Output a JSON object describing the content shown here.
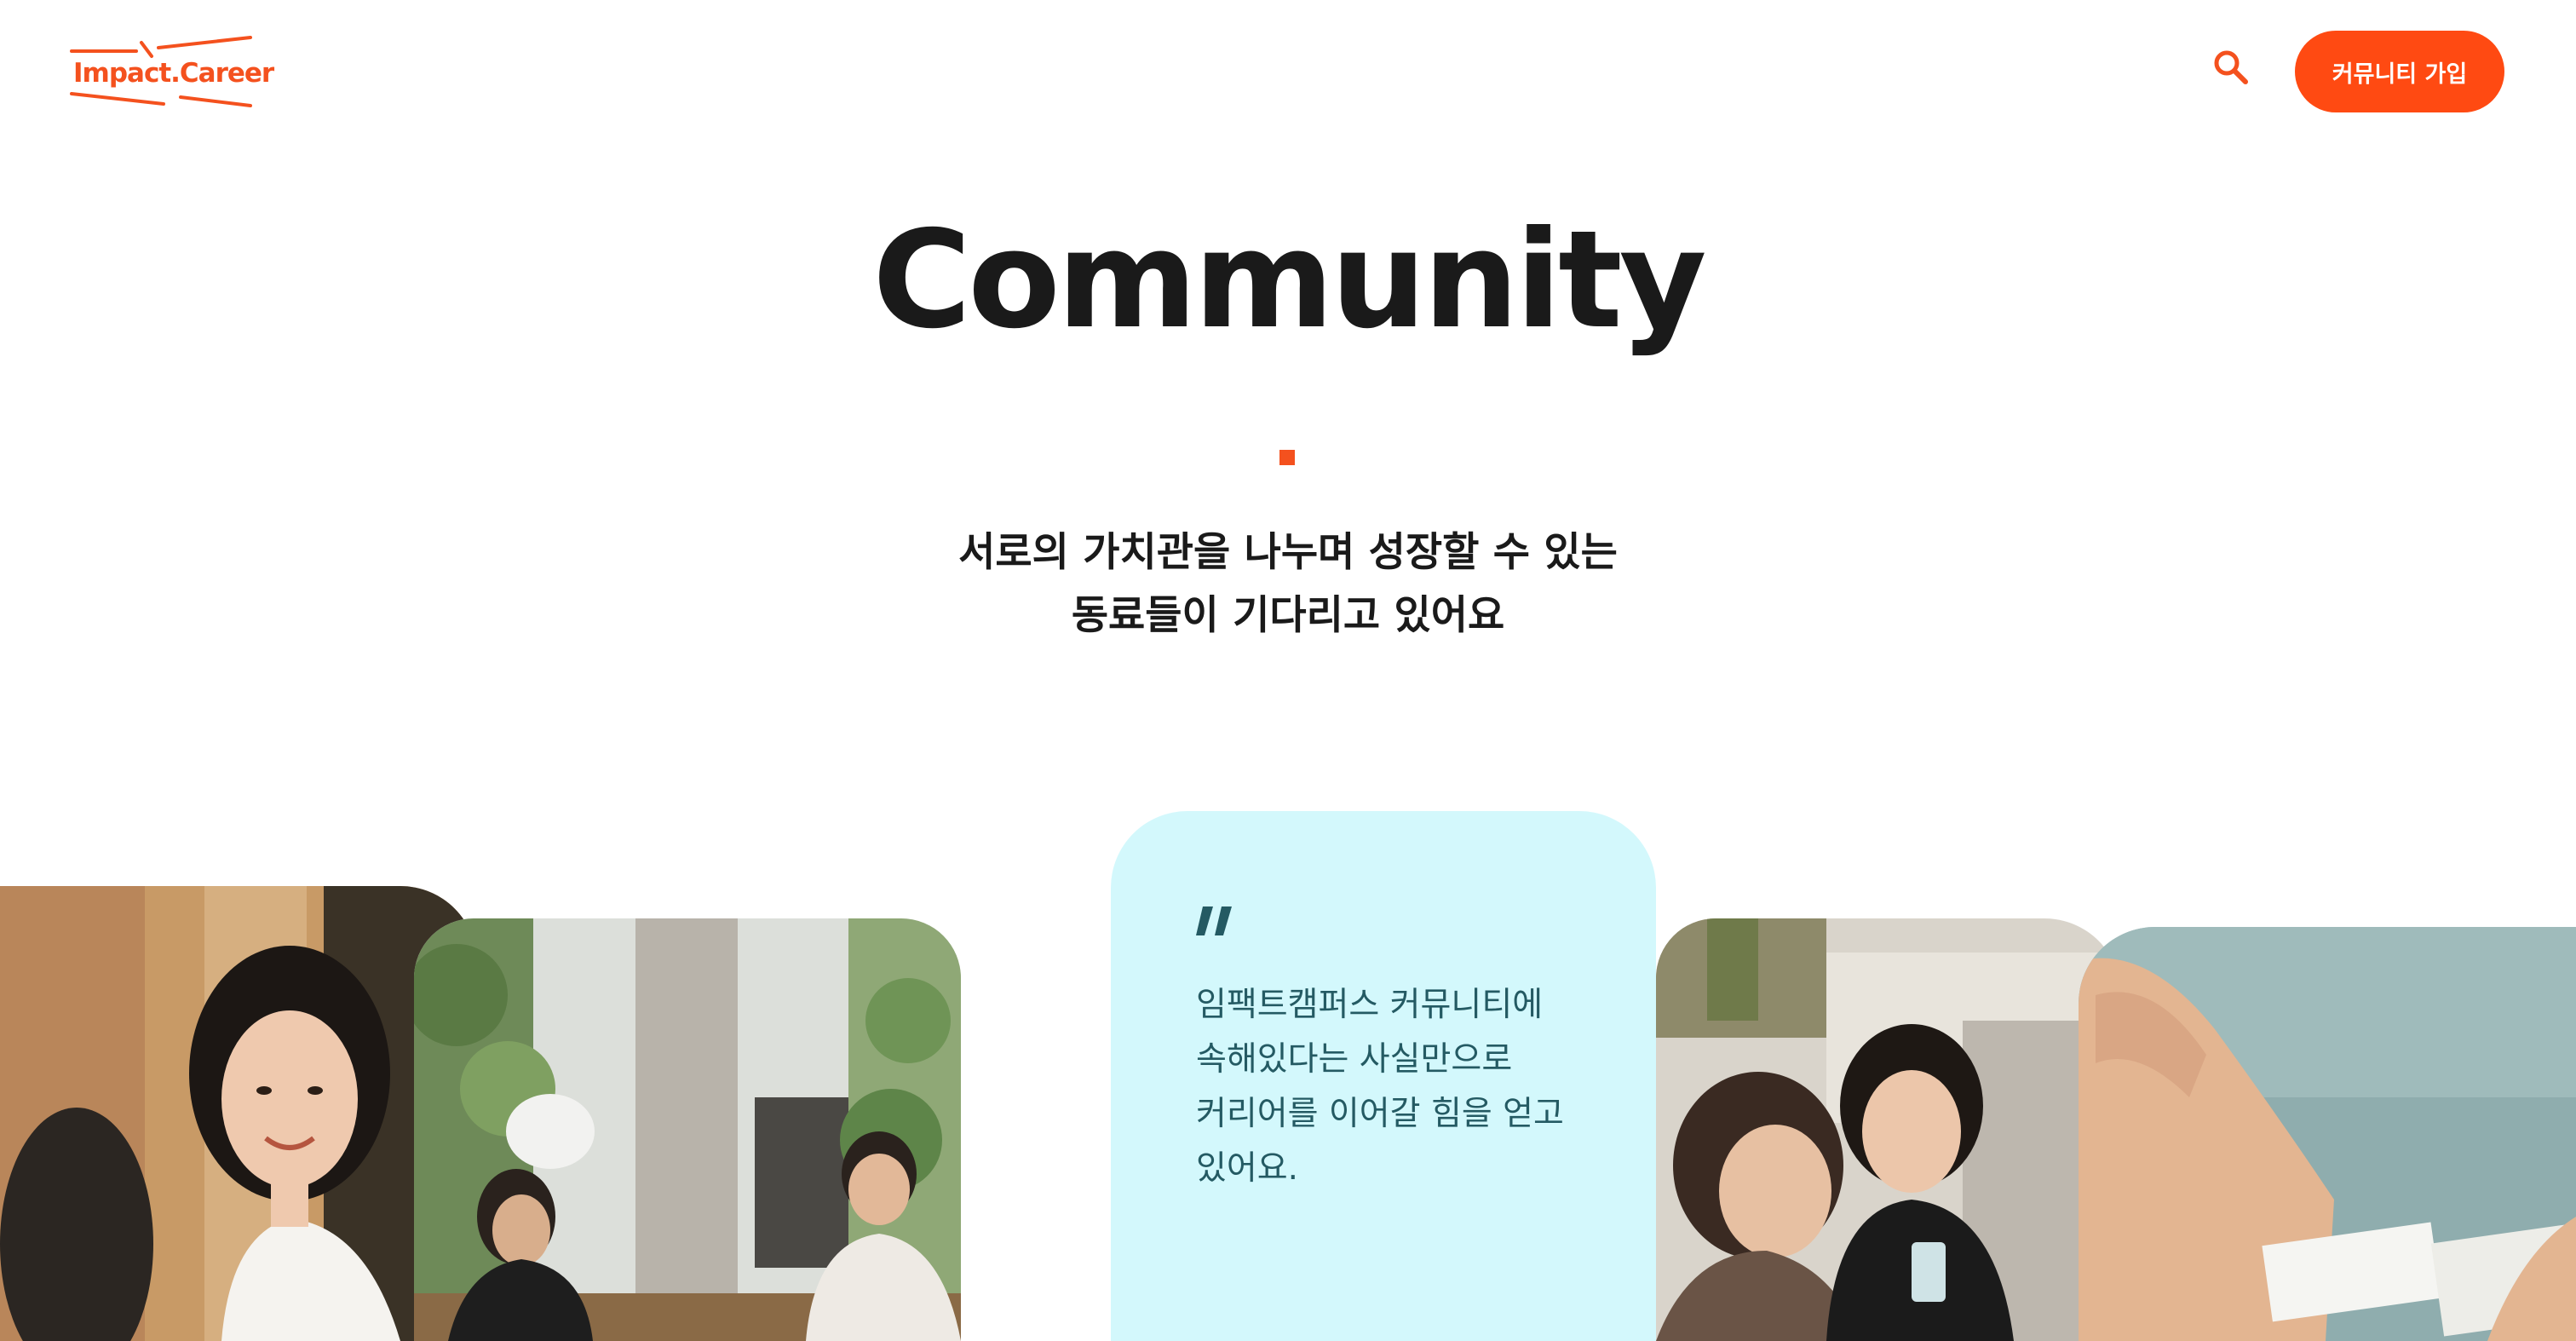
{
  "header": {
    "logo_text": "Impact.Career",
    "search_icon": "search-icon",
    "join_button_label": "커뮤니티 가입"
  },
  "hero": {
    "title": "Community",
    "subtitle_lines": [
      "서로의 가치관을 나누며 성장할 수 있는",
      "동료들이 기다리고 있어요"
    ]
  },
  "testimonial": {
    "quote_icon": "quote-icon",
    "lines": [
      "임팩트캠퍼스 커뮤니티에",
      "속해있다는 사실만으로",
      "커리어를 이어갈 힘을 얻고",
      "있어요."
    ]
  },
  "colors": {
    "brand": "#F4511E",
    "button": "#FF4A12",
    "quote_card_bg": "#D3F8FC",
    "quote_text": "#245A63"
  }
}
